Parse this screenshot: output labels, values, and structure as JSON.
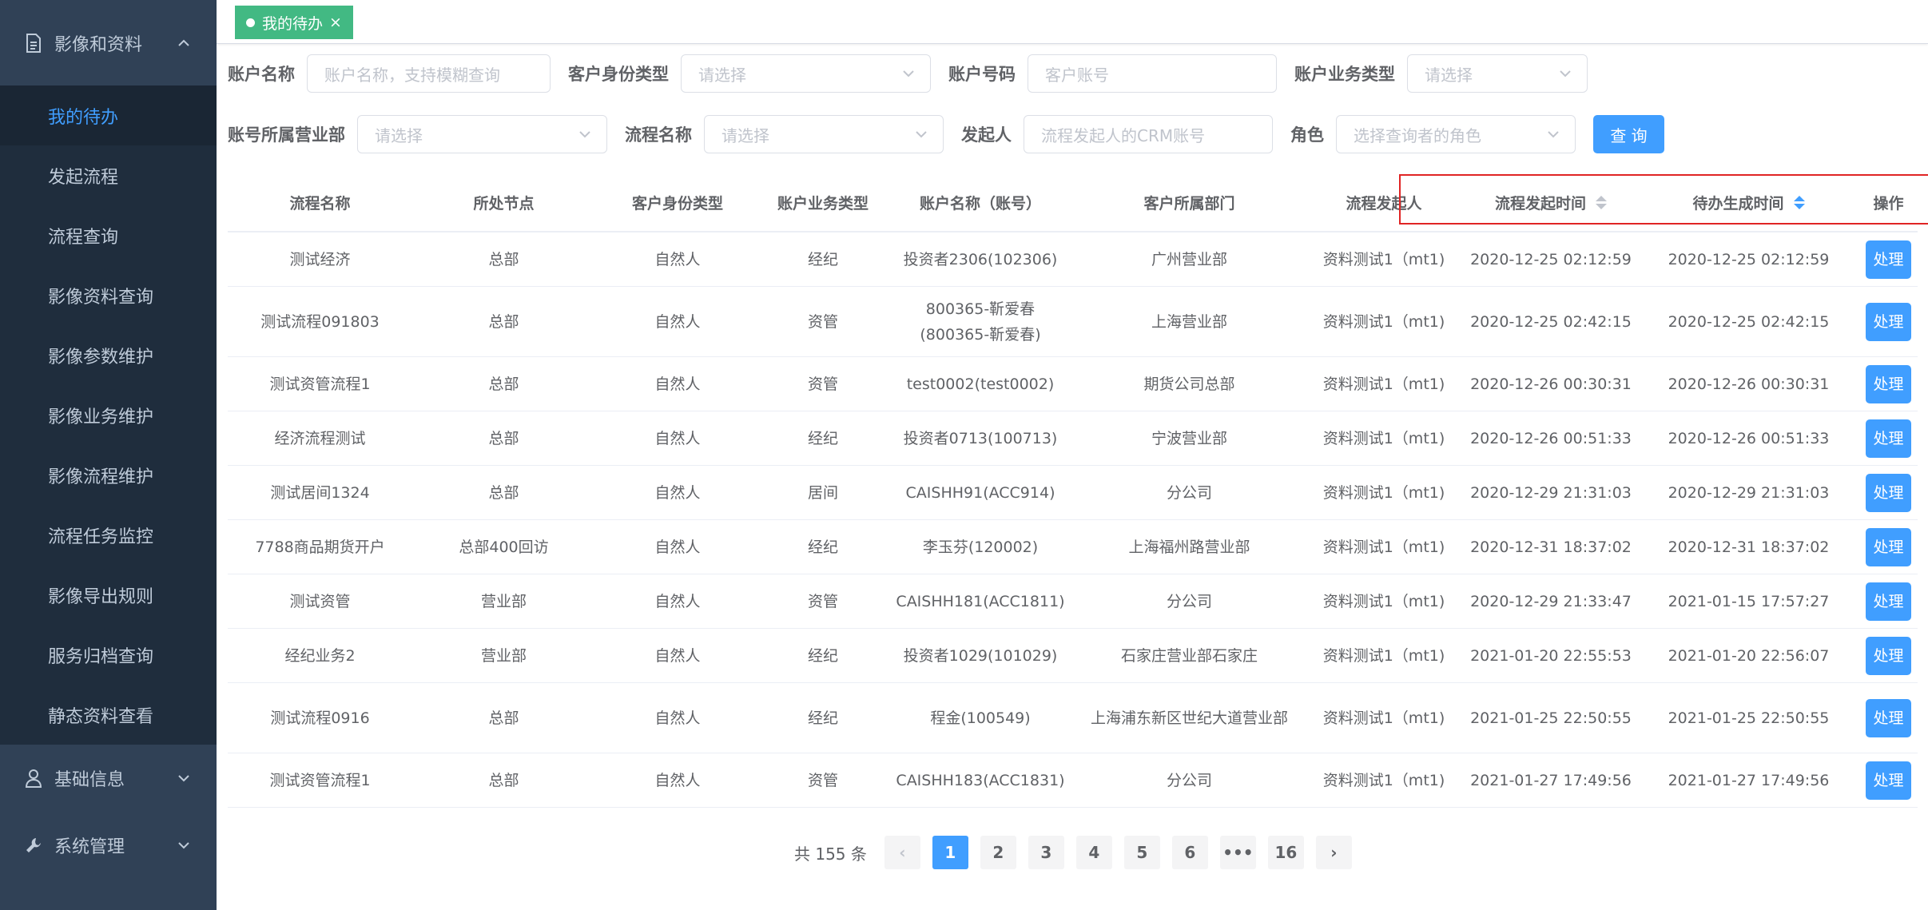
{
  "sidebar": {
    "group1": {
      "label": "影像和资料",
      "icon": "document-icon"
    },
    "items": [
      {
        "label": "我的待办",
        "active": true
      },
      {
        "label": "发起流程"
      },
      {
        "label": "流程查询"
      },
      {
        "label": "影像资料查询"
      },
      {
        "label": "影像参数维护"
      },
      {
        "label": "影像业务维护"
      },
      {
        "label": "影像流程维护"
      },
      {
        "label": "流程任务监控"
      },
      {
        "label": "影像导出规则"
      },
      {
        "label": "服务归档查询"
      },
      {
        "label": "静态资料查看"
      }
    ],
    "group2": {
      "label": "基础信息",
      "icon": "user-icon"
    },
    "group3": {
      "label": "系统管理",
      "icon": "wrench-icon"
    }
  },
  "tag": {
    "label": "我的待办",
    "close": "×"
  },
  "filters": {
    "account_name": {
      "label": "账户名称",
      "placeholder": "账户名称，支持模糊查询"
    },
    "id_type": {
      "label": "客户身份类型",
      "placeholder": "请选择"
    },
    "account_no": {
      "label": "账户号码",
      "placeholder": "客户账号"
    },
    "biz_type": {
      "label": "账户业务类型",
      "placeholder": "请选择"
    },
    "dept": {
      "label": "账号所属营业部",
      "placeholder": "请选择"
    },
    "flow_name": {
      "label": "流程名称",
      "placeholder": "请选择"
    },
    "initiator": {
      "label": "发起人",
      "placeholder": "流程发起人的CRM账号"
    },
    "role": {
      "label": "角色",
      "placeholder": "选择查询者的角色"
    },
    "query_button": "查 询"
  },
  "table": {
    "headers": [
      "流程名称",
      "所处节点",
      "客户身份类型",
      "账户业务类型",
      "账户名称（账号）",
      "客户所属部门",
      "流程发起人",
      "流程发起时间",
      "待办生成时间",
      "操作"
    ],
    "action_label": "处理",
    "rows": [
      [
        "测试经济",
        "总部",
        "自然人",
        "经纪",
        "投资者2306(102306)",
        "广州营业部",
        "资料测试1（mt1)",
        "2020-12-25 02:12:59",
        "2020-12-25 02:12:59"
      ],
      [
        "测试流程091803",
        "总部",
        "自然人",
        "资管",
        "800365-靳爱春(800365-靳爱春)",
        "上海营业部",
        "资料测试1（mt1)",
        "2020-12-25 02:42:15",
        "2020-12-25 02:42:15"
      ],
      [
        "测试资管流程1",
        "总部",
        "自然人",
        "资管",
        "test0002(test0002)",
        "期货公司总部",
        "资料测试1（mt1)",
        "2020-12-26 00:30:31",
        "2020-12-26 00:30:31"
      ],
      [
        "经济流程测试",
        "总部",
        "自然人",
        "经纪",
        "投资者0713(100713)",
        "宁波营业部",
        "资料测试1（mt1)",
        "2020-12-26 00:51:33",
        "2020-12-26 00:51:33"
      ],
      [
        "测试居间1324",
        "总部",
        "自然人",
        "居间",
        "CAISHH91(ACC914)",
        "分公司",
        "资料测试1（mt1)",
        "2020-12-29 21:31:03",
        "2020-12-29 21:31:03"
      ],
      [
        "7788商品期货开户",
        "总部400回访",
        "自然人",
        "经纪",
        "李玉芬(120002)",
        "上海福州路营业部",
        "资料测试1（mt1)",
        "2020-12-31 18:37:02",
        "2020-12-31 18:37:02"
      ],
      [
        "测试资管",
        "营业部",
        "自然人",
        "资管",
        "CAISHH181(ACC1811)",
        "分公司",
        "资料测试1（mt1)",
        "2020-12-29 21:33:47",
        "2021-01-15 17:57:27"
      ],
      [
        "经纪业务2",
        "营业部",
        "自然人",
        "经纪",
        "投资者1029(101029)",
        "石家庄营业部石家庄",
        "资料测试1（mt1)",
        "2021-01-20 22:55:53",
        "2021-01-20 22:56:07"
      ],
      [
        "测试流程0916",
        "总部",
        "自然人",
        "经纪",
        "程金(100549)",
        "上海浦东新区世纪大道营业部",
        "资料测试1（mt1)",
        "2021-01-25 22:50:55",
        "2021-01-25 22:50:55"
      ],
      [
        "测试资管流程1",
        "总部",
        "自然人",
        "资管",
        "CAISHH183(ACC1831)",
        "分公司",
        "资料测试1（mt1)",
        "2021-01-27 17:49:56",
        "2021-01-27 17:49:56"
      ]
    ]
  },
  "pagination": {
    "total": "共 155 条",
    "prev": "‹",
    "next": "›",
    "pages": [
      "1",
      "2",
      "3",
      "4",
      "5",
      "6",
      "•••",
      "16"
    ],
    "current": "1"
  },
  "colors": {
    "primary": "#409eff",
    "tag": "#42b983",
    "sidebar": "#304156",
    "highlight": "#e02424"
  }
}
